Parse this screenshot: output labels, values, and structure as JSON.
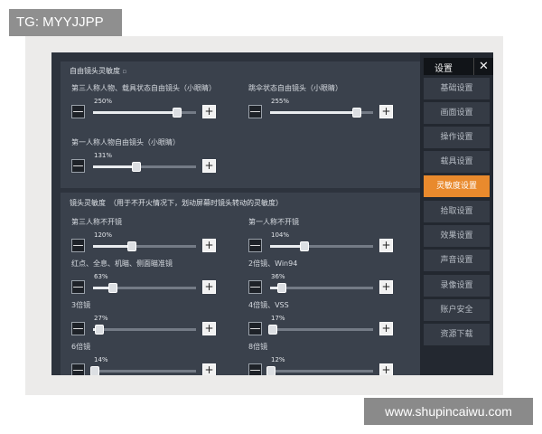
{
  "watermarks": {
    "top_left": "TG: MYYJJPP",
    "bottom_right": "www.shupincaiwu.com"
  },
  "menu": {
    "title": "设置",
    "close": "✕",
    "items": [
      {
        "label": "基础设置",
        "active": false
      },
      {
        "label": "画面设置",
        "active": false
      },
      {
        "label": "操作设置",
        "active": false
      },
      {
        "label": "载具设置",
        "active": false
      },
      {
        "label": "灵敏度设置",
        "active": true
      },
      {
        "label": "拾取设置",
        "active": false
      },
      {
        "label": "效果设置",
        "active": false
      },
      {
        "label": "声音设置",
        "active": false
      },
      {
        "label": "录像设置",
        "active": false
      },
      {
        "label": "账户安全",
        "active": false
      },
      {
        "label": "资源下载",
        "active": false
      }
    ]
  },
  "free_look": {
    "title": "自由镜头灵敏度",
    "info_icon": "info-icon",
    "items": [
      {
        "label": "第三人称人物、载具状态自由镜头（小眼睛）",
        "value": "250%",
        "level": 0.82
      },
      {
        "label": "跳伞状态自由镜头（小眼睛）",
        "value": "255%",
        "level": 0.84
      },
      {
        "label": "第一人称人物自由镜头（小眼睛）",
        "value": "131%",
        "level": 0.42
      }
    ]
  },
  "camera": {
    "title": "镜头灵敏度　（用于不开火情况下，划动屏幕时镜头转动的灵敏度）",
    "items": [
      {
        "label": "第三人称不开镜",
        "value": "120%",
        "level": 0.38
      },
      {
        "label": "第一人称不开镜",
        "value": "104%",
        "level": 0.33
      },
      {
        "label": "红点、全息、机瞄、侧面瞄准镜",
        "value": "63%",
        "level": 0.19
      },
      {
        "label": "2倍镜、Win94",
        "value": "36%",
        "level": 0.11
      },
      {
        "label": "3倍镜",
        "value": "27%",
        "level": 0.06
      },
      {
        "label": "4倍镜、VSS",
        "value": "17%",
        "level": 0.03
      },
      {
        "label": "6倍镜",
        "value": "14%",
        "level": 0.02
      },
      {
        "label": "8倍镜",
        "value": "12%",
        "level": 0.01
      }
    ]
  },
  "controls": {
    "minus": "—",
    "plus": "+"
  }
}
